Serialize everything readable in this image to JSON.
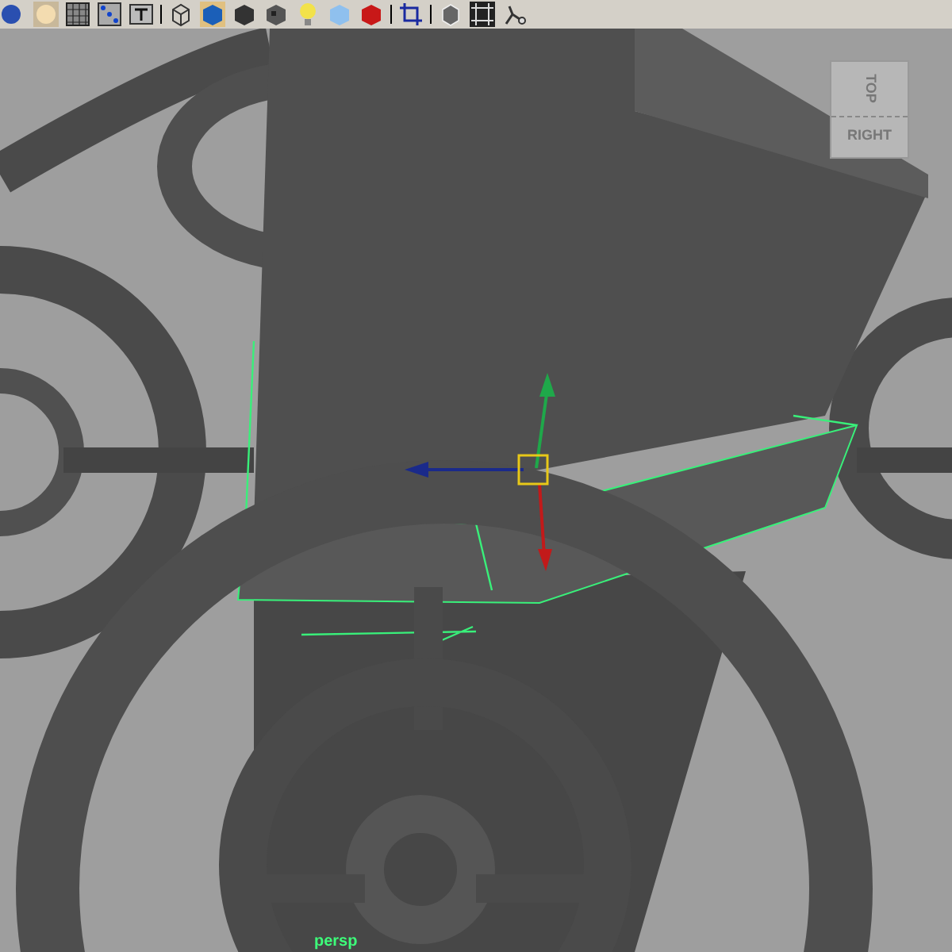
{
  "view_cube": {
    "top_label": "TOP",
    "right_label": "RIGHT"
  },
  "camera_label": "persp"
}
